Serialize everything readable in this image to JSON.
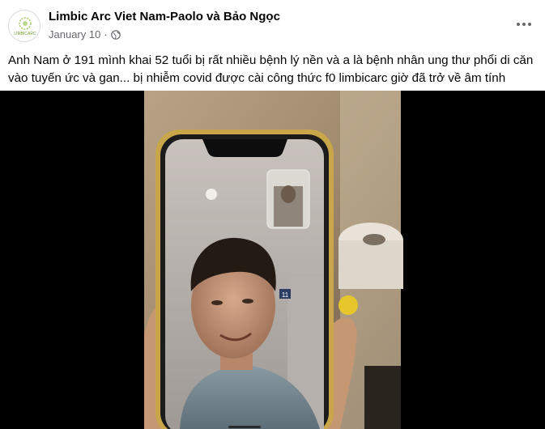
{
  "post": {
    "page_name": "Limbic Arc Viet Nam-Paolo và Bảo Ngọc",
    "date": "January 10",
    "separator": "·",
    "privacy_icon": "globe-icon",
    "more_icon": "more-options-icon",
    "avatar_logo_text": "LIMBICARC",
    "caption": "Anh Nam ở 191 mình khai 52 tuổi bị rất nhiều bệnh lý nền và a là bệnh nhân ung thư phổi di căn vào tuyến ức và gan... bị nhiễm covid được cài công thức f0 limbicarc giờ đã trở về âm tính"
  },
  "video": {
    "kind": "phone video call recording",
    "call_badge": "11"
  },
  "colors": {
    "text_primary": "#050505",
    "text_secondary": "#65676b",
    "video_background": "#000000",
    "logo_green": "#8cbf3f"
  }
}
